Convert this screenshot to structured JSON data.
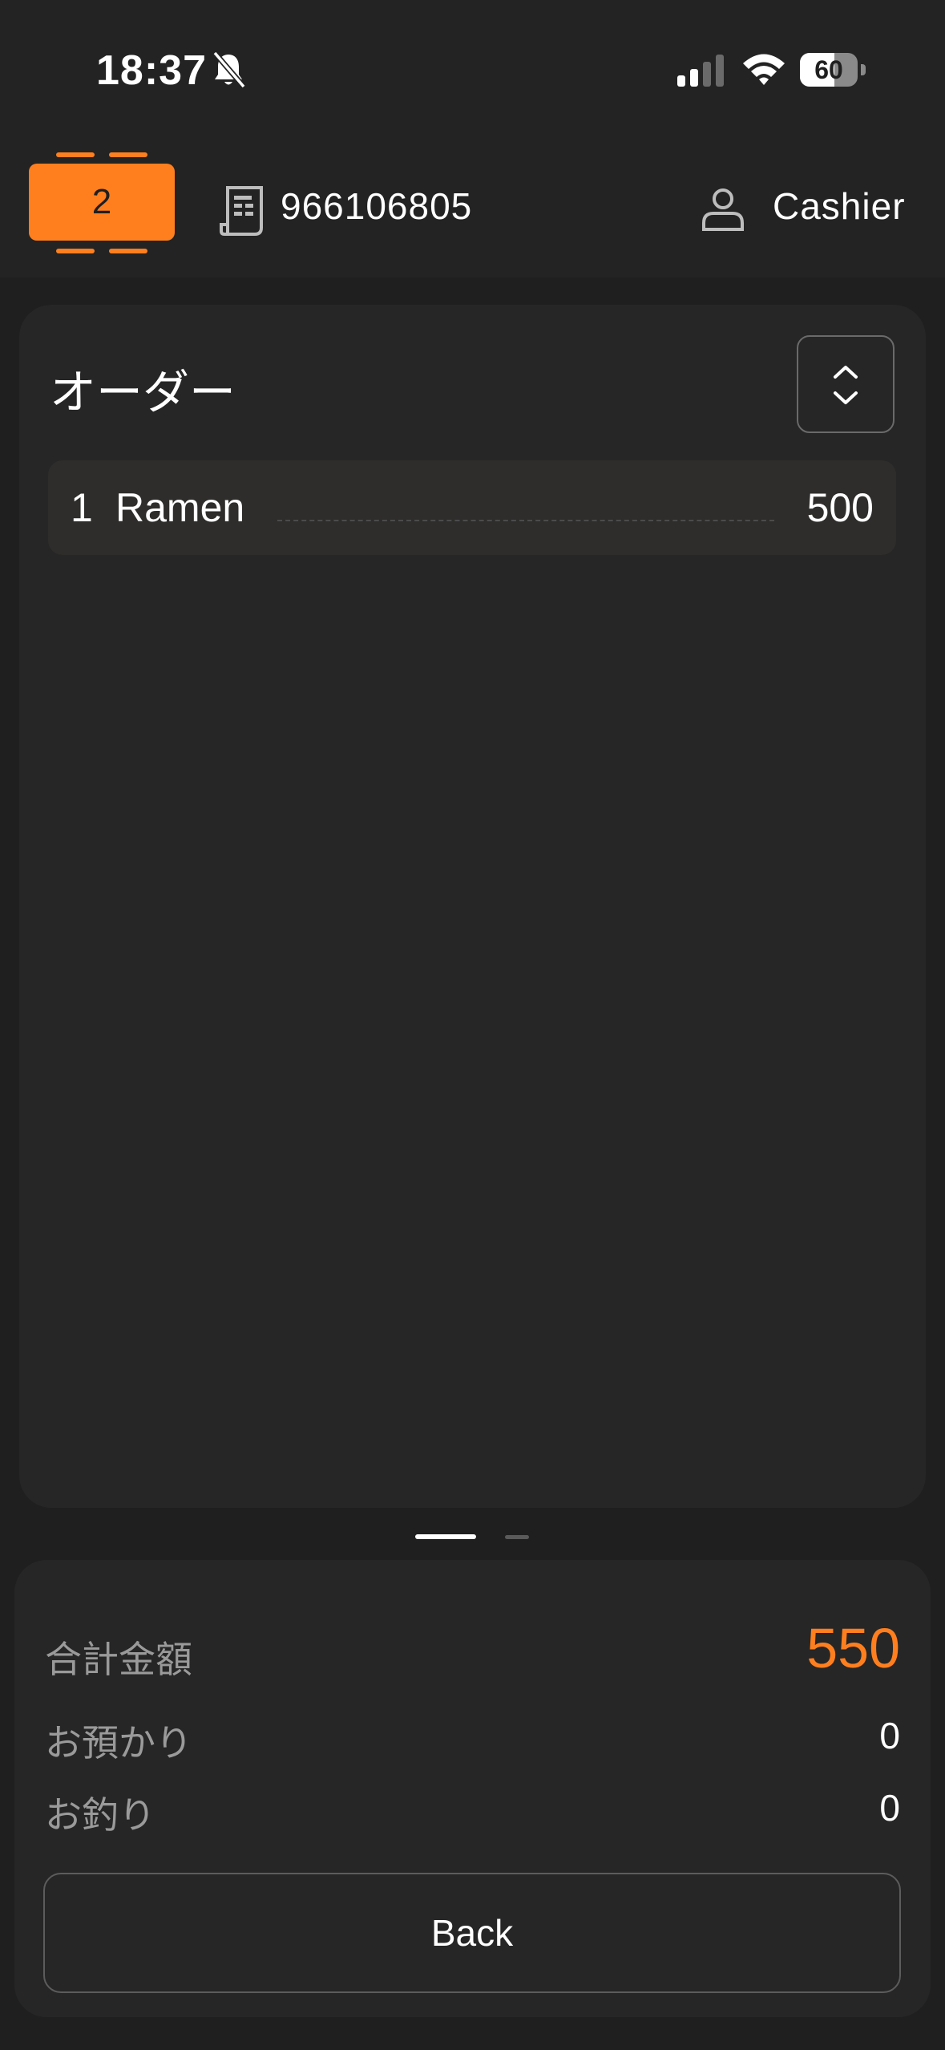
{
  "status_bar": {
    "time": "18:37",
    "battery_percent": "60",
    "icons": [
      "bell-slash-icon",
      "cellular-signal-icon",
      "wifi-icon",
      "battery-icon"
    ]
  },
  "header": {
    "table_number": "2",
    "order_number": "966106805",
    "user_role": "Cashier",
    "icons": [
      "table-icon",
      "receipt-icon",
      "user-icon"
    ]
  },
  "order": {
    "title": "オーダー",
    "sort_icon": "chevron-up-down-icon",
    "items": [
      {
        "qty": "1",
        "name": "Ramen",
        "price": "500"
      }
    ]
  },
  "pager": {
    "current_page": 1,
    "page_count": 2
  },
  "totals": {
    "total_label": "合計金額",
    "total_value": "550",
    "received_label": "お預かり",
    "received_value": "0",
    "change_label": "お釣り",
    "change_value": "0",
    "back_label": "Back"
  },
  "colors": {
    "accent": "#ff7f1f",
    "background": "#1f1f1f",
    "panel": "#262626",
    "item_row": "#2e2d2b"
  }
}
